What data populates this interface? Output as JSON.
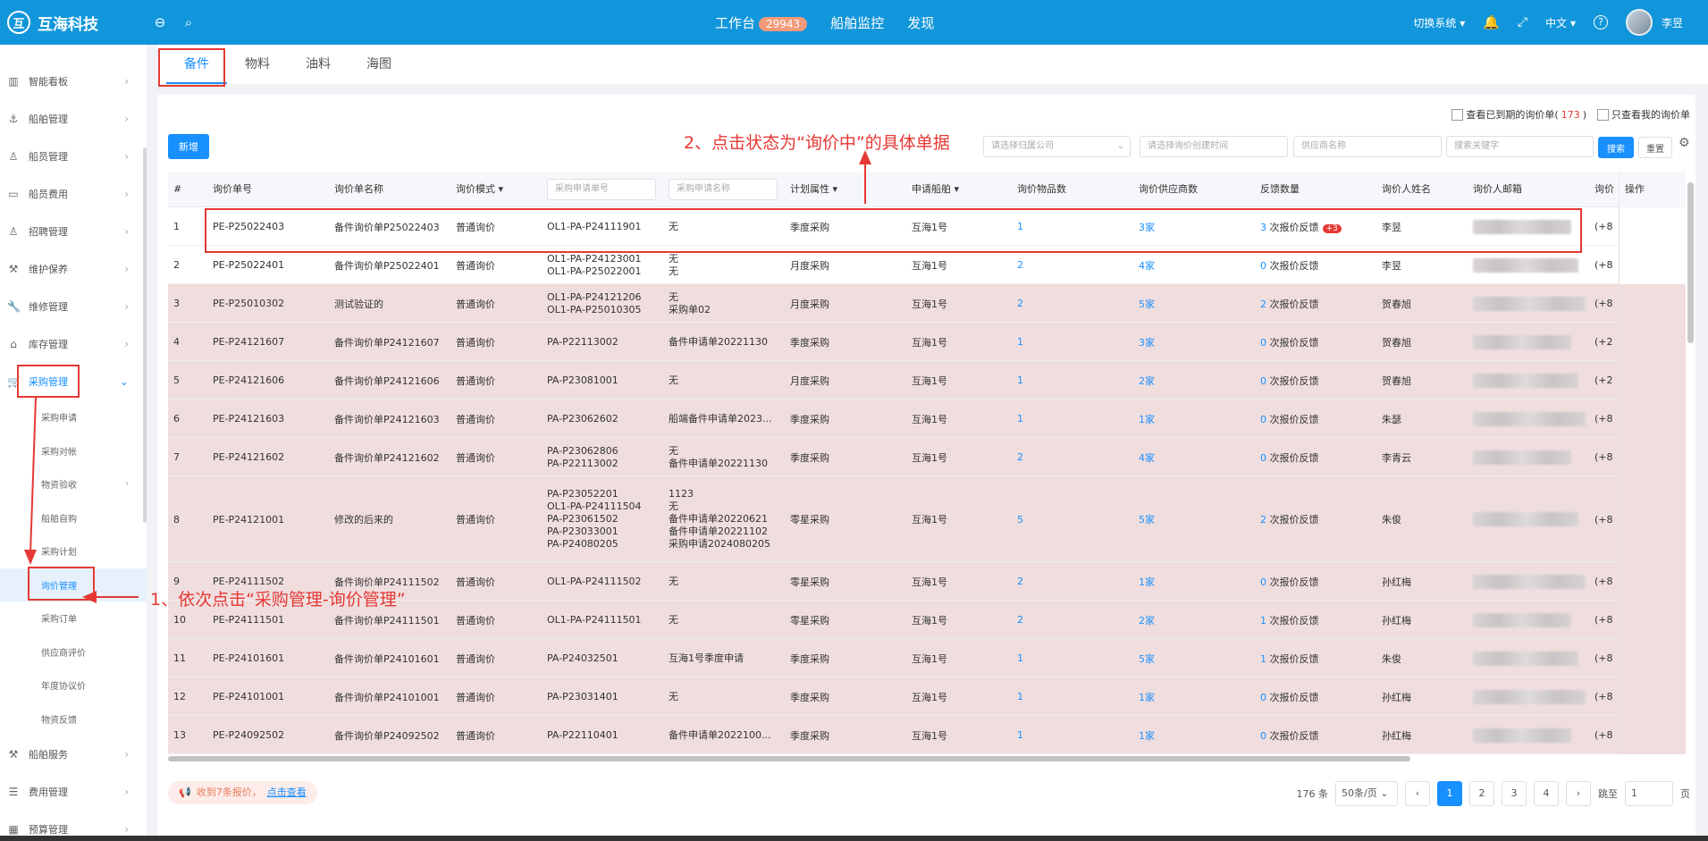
{
  "topbar": {
    "logo_mark": "互",
    "logo_text": "互海科技",
    "center": {
      "workbench": "工作台",
      "workbench_count": "29943",
      "ship_monitor": "船舶监控",
      "discover": "发现"
    },
    "switch_system": "切换系统",
    "language": "中文",
    "user_name": "李昱"
  },
  "sidebar": {
    "items": [
      {
        "label": "智能看板"
      },
      {
        "label": "船舶管理"
      },
      {
        "label": "船员管理"
      },
      {
        "label": "船员费用"
      },
      {
        "label": "招聘管理"
      },
      {
        "label": "维护保养"
      },
      {
        "label": "维修管理"
      },
      {
        "label": "库存管理"
      },
      {
        "label": "采购管理"
      }
    ],
    "sub_items": [
      {
        "label": "采购申请"
      },
      {
        "label": "采购对帐"
      },
      {
        "label": "物资验收"
      },
      {
        "label": "船舶自购"
      },
      {
        "label": "采购计划"
      },
      {
        "label": "询价管理"
      },
      {
        "label": "采购订单"
      },
      {
        "label": "供应商评价"
      },
      {
        "label": "年度协议价"
      },
      {
        "label": "物资反馈"
      }
    ],
    "bottom_items": [
      {
        "label": "船舶服务"
      },
      {
        "label": "费用管理"
      },
      {
        "label": "预算管理"
      }
    ]
  },
  "tabs": [
    {
      "label": "备件"
    },
    {
      "label": "物料"
    },
    {
      "label": "油料"
    },
    {
      "label": "海图"
    }
  ],
  "toolbar": {
    "new_label": "新增",
    "check_expired": "查看已到期的询价单(",
    "check_expired_count": "173",
    "check_expired_close": ")",
    "check_mine": "只查看我的询价单",
    "company_placeholder": "请选择归属公司",
    "date_placeholder": "请选择询价创建时间",
    "supplier_placeholder": "供应商名称",
    "keyword_placeholder": "搜索关键字",
    "search_label": "搜索",
    "reset_label": "重置"
  },
  "table": {
    "headers": {
      "index": "#",
      "no": "询价单号",
      "name": "询价单名称",
      "mode": "询价模式",
      "apply_no_placeholder": "采购申请单号",
      "apply_name_placeholder": "采购申请名称",
      "plan": "计划属性",
      "ship": "申请船舶",
      "goods": "询价物品数",
      "suppliers": "询价供应商数",
      "feedback": "反馈数量",
      "person": "询价人姓名",
      "email": "询价人邮箱",
      "phone": "询价",
      "op": "操作"
    },
    "rows": [
      {
        "idx": "1",
        "no": "PE-P25022403",
        "name": "备件询价单P25022403",
        "mode": "普通询价",
        "apply": [
          "OL1-PA-P24111901"
        ],
        "apply_name": [
          "无"
        ],
        "plan": "季度采购",
        "ship": "互海1号",
        "goods": "1",
        "suppliers": "3家",
        "fb_n": "3",
        "fb_text": "次报价反馈",
        "tag": "+3",
        "person": "李昱",
        "phone": "(+8"
      },
      {
        "idx": "2",
        "no": "PE-P25022401",
        "name": "备件询价单P25022401",
        "mode": "普通询价",
        "apply": [
          "OL1-PA-P24123001",
          "OL1-PA-P25022001"
        ],
        "apply_name": [
          "无",
          "无"
        ],
        "plan": "月度采购",
        "ship": "互海1号",
        "goods": "2",
        "suppliers": "4家",
        "fb_n": "0",
        "fb_text": "次报价反馈",
        "tag": "",
        "person": "李昱",
        "phone": "(+8"
      },
      {
        "idx": "3",
        "no": "PE-P25010302",
        "name": "测试验证的",
        "mode": "普通询价",
        "apply": [
          "OL1-PA-P24121206",
          "OL1-PA-P25010305"
        ],
        "apply_name": [
          "无",
          "采购单02"
        ],
        "plan": "月度采购",
        "ship": "互海1号",
        "goods": "2",
        "suppliers": "5家",
        "fb_n": "2",
        "fb_text": "次报价反馈",
        "tag": "",
        "person": "贺春旭",
        "phone": "(+8"
      },
      {
        "idx": "4",
        "no": "PE-P24121607",
        "name": "备件询价单P24121607",
        "mode": "普通询价",
        "apply": [
          "PA-P22113002"
        ],
        "apply_name": [
          "备件申请单20221130"
        ],
        "plan": "季度采购",
        "ship": "互海1号",
        "goods": "1",
        "suppliers": "3家",
        "fb_n": "0",
        "fb_text": "次报价反馈",
        "tag": "",
        "person": "贺春旭",
        "phone": "(+2"
      },
      {
        "idx": "5",
        "no": "PE-P24121606",
        "name": "备件询价单P24121606",
        "mode": "普通询价",
        "apply": [
          "PA-P23081001"
        ],
        "apply_name": [
          "无"
        ],
        "plan": "月度采购",
        "ship": "互海1号",
        "goods": "1",
        "suppliers": "2家",
        "fb_n": "0",
        "fb_text": "次报价反馈",
        "tag": "",
        "person": "贺春旭",
        "phone": "(+2"
      },
      {
        "idx": "6",
        "no": "PE-P24121603",
        "name": "备件询价单P24121603",
        "mode": "普通询价",
        "apply": [
          "PA-P23062602"
        ],
        "apply_name": [
          "船端备件申请单2023..."
        ],
        "plan": "季度采购",
        "ship": "互海1号",
        "goods": "1",
        "suppliers": "1家",
        "fb_n": "0",
        "fb_text": "次报价反馈",
        "tag": "",
        "person": "朱瑟",
        "phone": "(+8"
      },
      {
        "idx": "7",
        "no": "PE-P24121602",
        "name": "备件询价单P24121602",
        "mode": "普通询价",
        "apply": [
          "PA-P23062806",
          "PA-P22113002"
        ],
        "apply_name": [
          "无",
          "备件申请单20221130"
        ],
        "plan": "季度采购",
        "ship": "互海1号",
        "goods": "2",
        "suppliers": "4家",
        "fb_n": "0",
        "fb_text": "次报价反馈",
        "tag": "",
        "person": "李青云",
        "phone": "(+8"
      },
      {
        "idx": "8",
        "no": "PE-P24121001",
        "name": "修改的后来的",
        "mode": "普通询价",
        "apply": [
          "PA-P23052201",
          "OL1-PA-P24111504",
          "PA-P23061502",
          "PA-P23033001",
          "PA-P24080205"
        ],
        "apply_name": [
          "1123",
          "无",
          "备件申请单20220621",
          "备件申请单20221102",
          "采购申请2024080205"
        ],
        "plan": "零星采购",
        "ship": "互海1号",
        "goods": "5",
        "suppliers": "5家",
        "fb_n": "2",
        "fb_text": "次报价反馈",
        "tag": "",
        "person": "朱俊",
        "phone": "(+8"
      },
      {
        "idx": "9",
        "no": "PE-P24111502",
        "name": "备件询价单P24111502",
        "mode": "普通询价",
        "apply": [
          "OL1-PA-P24111502"
        ],
        "apply_name": [
          "无"
        ],
        "plan": "零星采购",
        "ship": "互海1号",
        "goods": "2",
        "suppliers": "1家",
        "fb_n": "0",
        "fb_text": "次报价反馈",
        "tag": "",
        "person": "孙红梅",
        "phone": "(+8"
      },
      {
        "idx": "10",
        "no": "PE-P24111501",
        "name": "备件询价单P24111501",
        "mode": "普通询价",
        "apply": [
          "OL1-PA-P24111501"
        ],
        "apply_name": [
          "无"
        ],
        "plan": "零星采购",
        "ship": "互海1号",
        "goods": "2",
        "suppliers": "2家",
        "fb_n": "1",
        "fb_text": "次报价反馈",
        "tag": "",
        "person": "孙红梅",
        "phone": "(+8"
      },
      {
        "idx": "11",
        "no": "PE-P24101601",
        "name": "备件询价单P24101601",
        "mode": "普通询价",
        "apply": [
          "PA-P24032501"
        ],
        "apply_name": [
          "互海1号季度申请"
        ],
        "plan": "季度采购",
        "ship": "互海1号",
        "goods": "1",
        "suppliers": "5家",
        "fb_n": "1",
        "fb_text": "次报价反馈",
        "tag": "",
        "person": "朱俊",
        "phone": "(+8"
      },
      {
        "idx": "12",
        "no": "PE-P24101001",
        "name": "备件询价单P24101001",
        "mode": "普通询价",
        "apply": [
          "PA-P23031401"
        ],
        "apply_name": [
          "无"
        ],
        "plan": "季度采购",
        "ship": "互海1号",
        "goods": "1",
        "suppliers": "1家",
        "fb_n": "0",
        "fb_text": "次报价反馈",
        "tag": "",
        "person": "孙红梅",
        "phone": "(+8"
      },
      {
        "idx": "13",
        "no": "PE-P24092502",
        "name": "备件询价单P24092502",
        "mode": "普通询价",
        "apply": [
          "PA-P22110401"
        ],
        "apply_name": [
          "备件申请单2022100..."
        ],
        "plan": "季度采购",
        "ship": "互海1号",
        "goods": "1",
        "suppliers": "1家",
        "fb_n": "0",
        "fb_text": "次报价反馈",
        "tag": "",
        "person": "孙红梅",
        "phone": "(+8"
      }
    ]
  },
  "notice": {
    "text": "收到7条报价，",
    "link": "点击查看"
  },
  "pager": {
    "total": "176 条",
    "page_size": "50条/页",
    "pages": [
      "1",
      "2",
      "3",
      "4"
    ],
    "jump_label": "跳至",
    "jump_value": "1",
    "page_suffix": "页"
  },
  "annotations": {
    "step1": "1、依次点击“采购管理-询价管理”",
    "step2": "2、点击状态为“询价中”的具体单据"
  },
  "colors": {
    "topbar": "#1296db",
    "accent": "#1890ff",
    "annotation": "#e53935",
    "row_highlight": "#f0dede"
  }
}
